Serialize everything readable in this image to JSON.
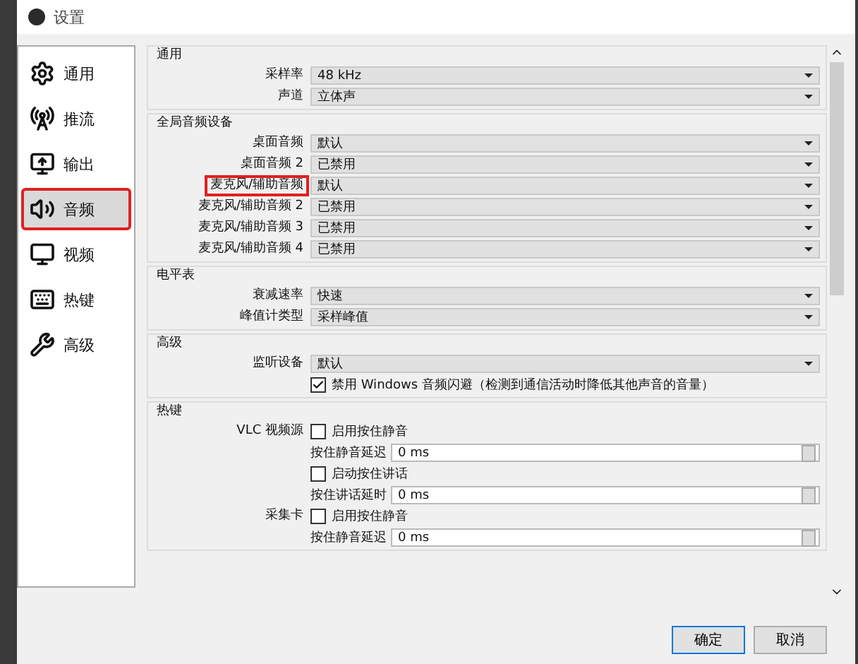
{
  "window": {
    "title": "设置"
  },
  "sidebar": {
    "items": [
      {
        "label": "通用",
        "selected": false,
        "annotated": false
      },
      {
        "label": "推流",
        "selected": false,
        "annotated": false
      },
      {
        "label": "输出",
        "selected": false,
        "annotated": false
      },
      {
        "label": "音频",
        "selected": true,
        "annotated": true
      },
      {
        "label": "视频",
        "selected": false,
        "annotated": false
      },
      {
        "label": "热键",
        "selected": false,
        "annotated": false
      },
      {
        "label": "高级",
        "selected": false,
        "annotated": false
      }
    ]
  },
  "groups": [
    {
      "title": "通用",
      "rows": [
        {
          "kind": "select",
          "label": "采样率",
          "value": "48 kHz",
          "annotated": false
        },
        {
          "kind": "select",
          "label": "声道",
          "value": "立体声",
          "annotated": false
        }
      ]
    },
    {
      "title": "全局音频设备",
      "rows": [
        {
          "kind": "select",
          "label": "桌面音频",
          "value": "默认",
          "annotated": false
        },
        {
          "kind": "select",
          "label": "桌面音频 2",
          "value": "已禁用",
          "annotated": false
        },
        {
          "kind": "select",
          "label": "麦克风/辅助音频",
          "value": "默认",
          "annotated": true
        },
        {
          "kind": "select",
          "label": "麦克风/辅助音频 2",
          "value": "已禁用",
          "annotated": false
        },
        {
          "kind": "select",
          "label": "麦克风/辅助音频 3",
          "value": "已禁用",
          "annotated": false
        },
        {
          "kind": "select",
          "label": "麦克风/辅助音频 4",
          "value": "已禁用",
          "annotated": false
        }
      ]
    },
    {
      "title": "电平表",
      "rows": [
        {
          "kind": "select",
          "label": "衰减速率",
          "value": "快速",
          "annotated": false
        },
        {
          "kind": "select",
          "label": "峰值计类型",
          "value": "采样峰值",
          "annotated": false
        }
      ]
    },
    {
      "title": "高级",
      "rows": [
        {
          "kind": "select",
          "label": "监听设备",
          "value": "默认",
          "annotated": false
        },
        {
          "kind": "checkbox",
          "label": "禁用 Windows 音频闪避（检测到通信活动时降低其他声音的音量）",
          "checked": true
        }
      ]
    },
    {
      "title": "热键",
      "rows": [
        {
          "kind": "checkbox",
          "source": "VLC 视频源",
          "label": "启用按住静音",
          "checked": false
        },
        {
          "kind": "spin",
          "label": "按住静音延迟",
          "value": "0 ms"
        },
        {
          "kind": "checkbox",
          "label": "启动按住讲话",
          "checked": false
        },
        {
          "kind": "spin",
          "label": "按住讲话延时",
          "value": "0 ms"
        },
        {
          "kind": "checkbox",
          "source": "采集卡",
          "label": "启用按住静音",
          "checked": false
        },
        {
          "kind": "spin",
          "label": "按住静音延迟",
          "value": "0 ms"
        }
      ]
    }
  ],
  "buttons": [
    "确定",
    "取消"
  ]
}
